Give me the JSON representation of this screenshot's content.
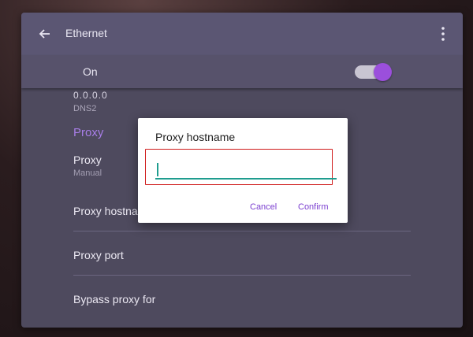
{
  "appbar": {
    "title": "Ethernet",
    "back_icon": "arrow-left-icon",
    "menu_icon": "more-vert-icon"
  },
  "toggle": {
    "label": "On",
    "state": "on",
    "accent_color": "#9b4fdc"
  },
  "settings": {
    "dns2_value": "0.0.0.0",
    "dns2_label": "DNS2",
    "section_header": "Proxy",
    "proxy_title": "Proxy",
    "proxy_value": "Manual",
    "proxy_hostname_title": "Proxy hostname",
    "proxy_port_title": "Proxy port",
    "bypass_title": "Bypass proxy for"
  },
  "dialog": {
    "title": "Proxy hostname",
    "input_value": "",
    "cancel_label": "Cancel",
    "confirm_label": "Confirm",
    "accent_color": "#7b3fd0",
    "input_color": "#1f9d8f"
  }
}
